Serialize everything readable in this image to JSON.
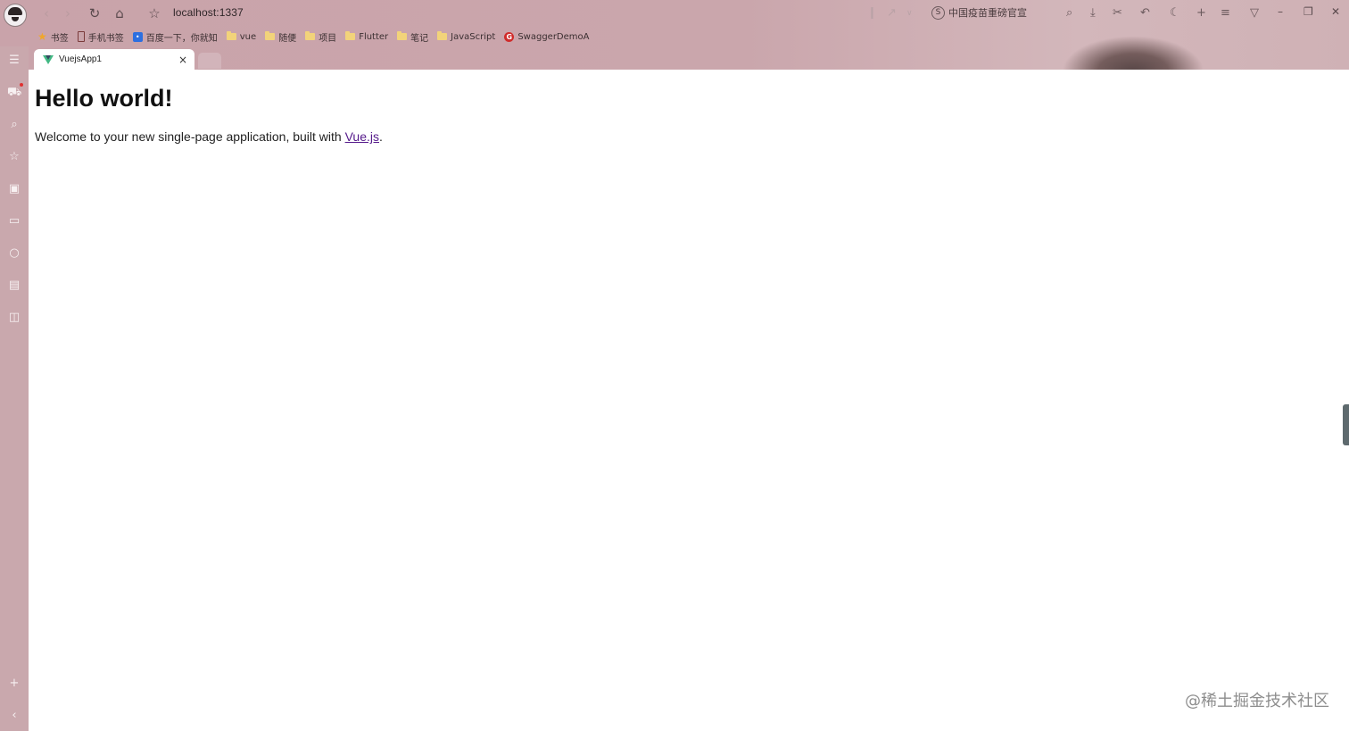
{
  "browser": {
    "address": "localhost:1337",
    "search_hint": "中国疫苗重磅官宣",
    "bookmarks": [
      "书签",
      "手机书签",
      "百度一下，你就知",
      "vue",
      "随便",
      "项目",
      "Flutter",
      "笔记",
      "JavaScript",
      "SwaggerDemoA"
    ],
    "tab": {
      "title": "VuejsApp1",
      "close": "×"
    }
  },
  "page": {
    "heading": "Hello world!",
    "welcome_text": "Welcome to your new single-page application, built with ",
    "link_text": "Vue.js",
    "trailing": "."
  },
  "watermark": "@稀土掘金技术社区",
  "icons": {
    "back": "back-icon",
    "forward": "forward-icon",
    "reload": "reload-icon",
    "home": "home-icon",
    "star": "star-icon",
    "sidebar": [
      "note-icon",
      "cart-icon",
      "search-icon",
      "star-icon",
      "video-icon",
      "ad-icon",
      "chat-icon",
      "translate-icon",
      "reader-icon",
      "plus-icon",
      "collapse-icon"
    ]
  },
  "colors": {
    "chrome": "#c9a8ad",
    "vue_green": "#41b883",
    "link": "#551a8b"
  }
}
